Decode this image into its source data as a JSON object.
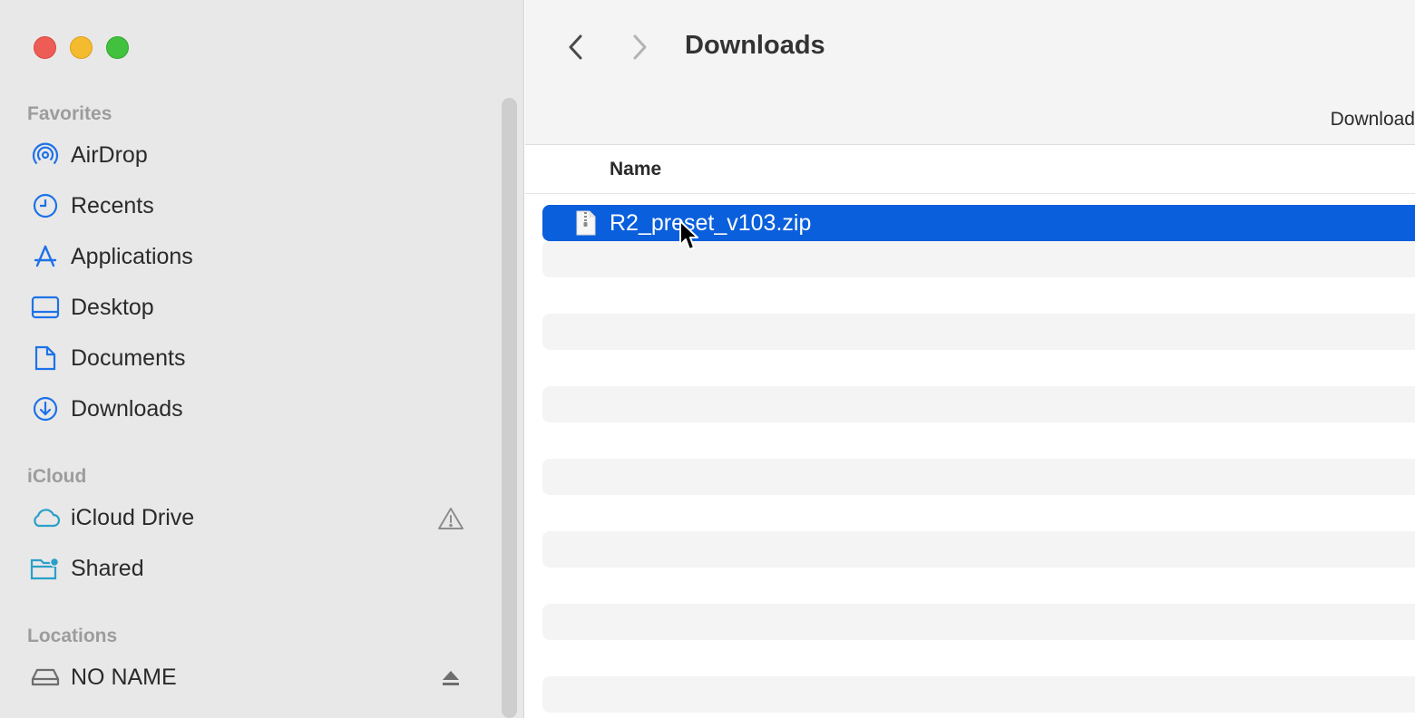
{
  "sidebar": {
    "sections": {
      "favorites": "Favorites",
      "icloud": "iCloud",
      "locations": "Locations"
    },
    "favorites": [
      {
        "label": "AirDrop",
        "icon": "airdrop-icon"
      },
      {
        "label": "Recents",
        "icon": "clock-icon"
      },
      {
        "label": "Applications",
        "icon": "applications-icon"
      },
      {
        "label": "Desktop",
        "icon": "desktop-icon"
      },
      {
        "label": "Documents",
        "icon": "document-icon"
      },
      {
        "label": "Downloads",
        "icon": "download-circle-icon"
      }
    ],
    "icloud": [
      {
        "label": "iCloud Drive",
        "icon": "cloud-icon",
        "trailing_icon": "warning-icon"
      },
      {
        "label": "Shared",
        "icon": "shared-folder-icon"
      }
    ],
    "locations": [
      {
        "label": "NO NAME",
        "icon": "drive-icon",
        "trailing_icon": "eject-icon"
      }
    ]
  },
  "toolbar": {
    "title": "Downloads",
    "path_label": "Download"
  },
  "list": {
    "column_name": "Name",
    "files": [
      {
        "name": "R2_preset_v103.zip",
        "icon": "zip-file-icon",
        "selected": true
      }
    ]
  },
  "colors": {
    "accent": "#0a5fdc",
    "sidebar_icon": "#1d72e8",
    "close": "#ee5d55",
    "minimize": "#f5bb2f",
    "maximize": "#42c13f"
  }
}
